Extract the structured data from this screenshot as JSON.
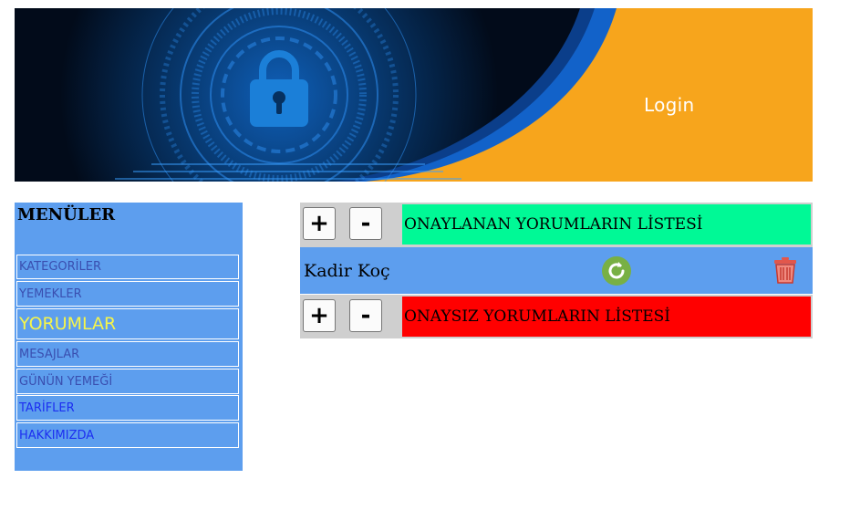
{
  "banner": {
    "login_label": "Login",
    "colors": {
      "dark": "#04172f",
      "accent": "#f7a51c",
      "wave": "#1262c9"
    },
    "icon": "padlock-icon"
  },
  "sidebar": {
    "title": "MENÜLER",
    "items": [
      {
        "label": "KATEGORİLER"
      },
      {
        "label": "YEMEKLER"
      },
      {
        "label": "YORUMLAR"
      },
      {
        "label": "MESAJLAR"
      },
      {
        "label": "GÜNÜN YEMEĞİ"
      },
      {
        "label": "TARİFLER"
      },
      {
        "label": "HAKKIMIZDA"
      }
    ],
    "active_item": "YORUMLAR"
  },
  "main": {
    "approved": {
      "expand_label": "+",
      "collapse_label": "-",
      "title": "ONAYLANAN YORUMLARIN LİSTESİ",
      "color": "#00f996"
    },
    "comments": [
      {
        "author": "Kadir Koç",
        "actions": [
          "refresh-icon",
          "trash-icon"
        ]
      }
    ],
    "unapproved": {
      "expand_label": "+",
      "collapse_label": "-",
      "title": "ONAYSIZ YORUMLARIN LİSTESİ",
      "color": "#ff0000"
    }
  }
}
